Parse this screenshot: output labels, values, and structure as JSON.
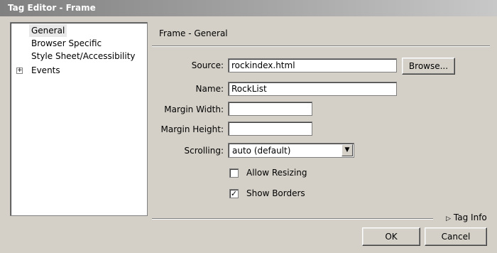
{
  "window": {
    "title": "Tag Editor - Frame"
  },
  "categories": [
    {
      "label": "General",
      "selected": true,
      "expandable": false
    },
    {
      "label": "Browser Specific",
      "selected": false,
      "expandable": false
    },
    {
      "label": "Style Sheet/Accessibility",
      "selected": false,
      "expandable": false
    },
    {
      "label": "Events",
      "selected": false,
      "expandable": true,
      "expander_glyph": "+"
    }
  ],
  "section": {
    "title": "Frame - General"
  },
  "fields": {
    "source": {
      "label": "Source:",
      "value": "rockindex.html"
    },
    "name": {
      "label": "Name:",
      "value": "RockList"
    },
    "margin_width": {
      "label": "Margin Width:",
      "value": ""
    },
    "margin_height": {
      "label": "Margin Height:",
      "value": ""
    },
    "scrolling": {
      "label": "Scrolling:",
      "selected": "auto (default)",
      "arrow_glyph": "▼"
    }
  },
  "buttons": {
    "browse": "Browse...",
    "ok": "OK",
    "cancel": "Cancel"
  },
  "checkboxes": {
    "allow_resizing": {
      "label": "Allow Resizing",
      "checked": false,
      "mark": ""
    },
    "show_borders": {
      "label": "Show Borders",
      "checked": true,
      "mark": "✓"
    }
  },
  "tag_info": {
    "label": "Tag Info",
    "glyph": "▷"
  }
}
